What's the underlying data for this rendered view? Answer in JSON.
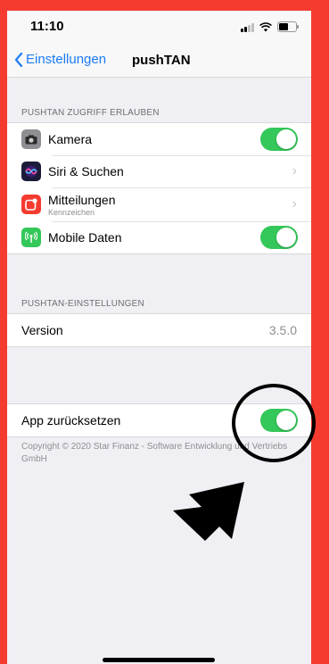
{
  "status_bar": {
    "time": "11:10"
  },
  "nav": {
    "back_label": "Einstellungen",
    "title": "pushTAN"
  },
  "access_section": {
    "header": "PUSHTAN ZUGRIFF ERLAUBEN",
    "items": [
      {
        "label": "Kamera",
        "icon": "camera-icon",
        "icon_color": "#8e8e93",
        "control": "toggle",
        "on": true
      },
      {
        "label": "Siri & Suchen",
        "icon": "siri-icon",
        "icon_color": "#1b1b3a",
        "control": "chevron"
      },
      {
        "label": "Mitteilungen",
        "sublabel": "Kennzeichen",
        "icon": "notifications-icon",
        "icon_color": "#f53b30",
        "control": "chevron"
      },
      {
        "label": "Mobile Daten",
        "icon": "cellular-icon",
        "icon_color": "#34c759",
        "control": "toggle",
        "on": true
      }
    ]
  },
  "settings_section": {
    "header": "PUSHTAN-EINSTELLUNGEN",
    "version_label": "Version",
    "version_value": "3.5.0"
  },
  "reset_section": {
    "label": "App zurücksetzen",
    "on": true,
    "copyright": "Copyright © 2020 Star Finanz - Software Entwicklung und Vertriebs GmbH"
  },
  "colors": {
    "accent": "#1a7cf5",
    "toggle_on": "#34c759",
    "frame": "#f53b30"
  }
}
